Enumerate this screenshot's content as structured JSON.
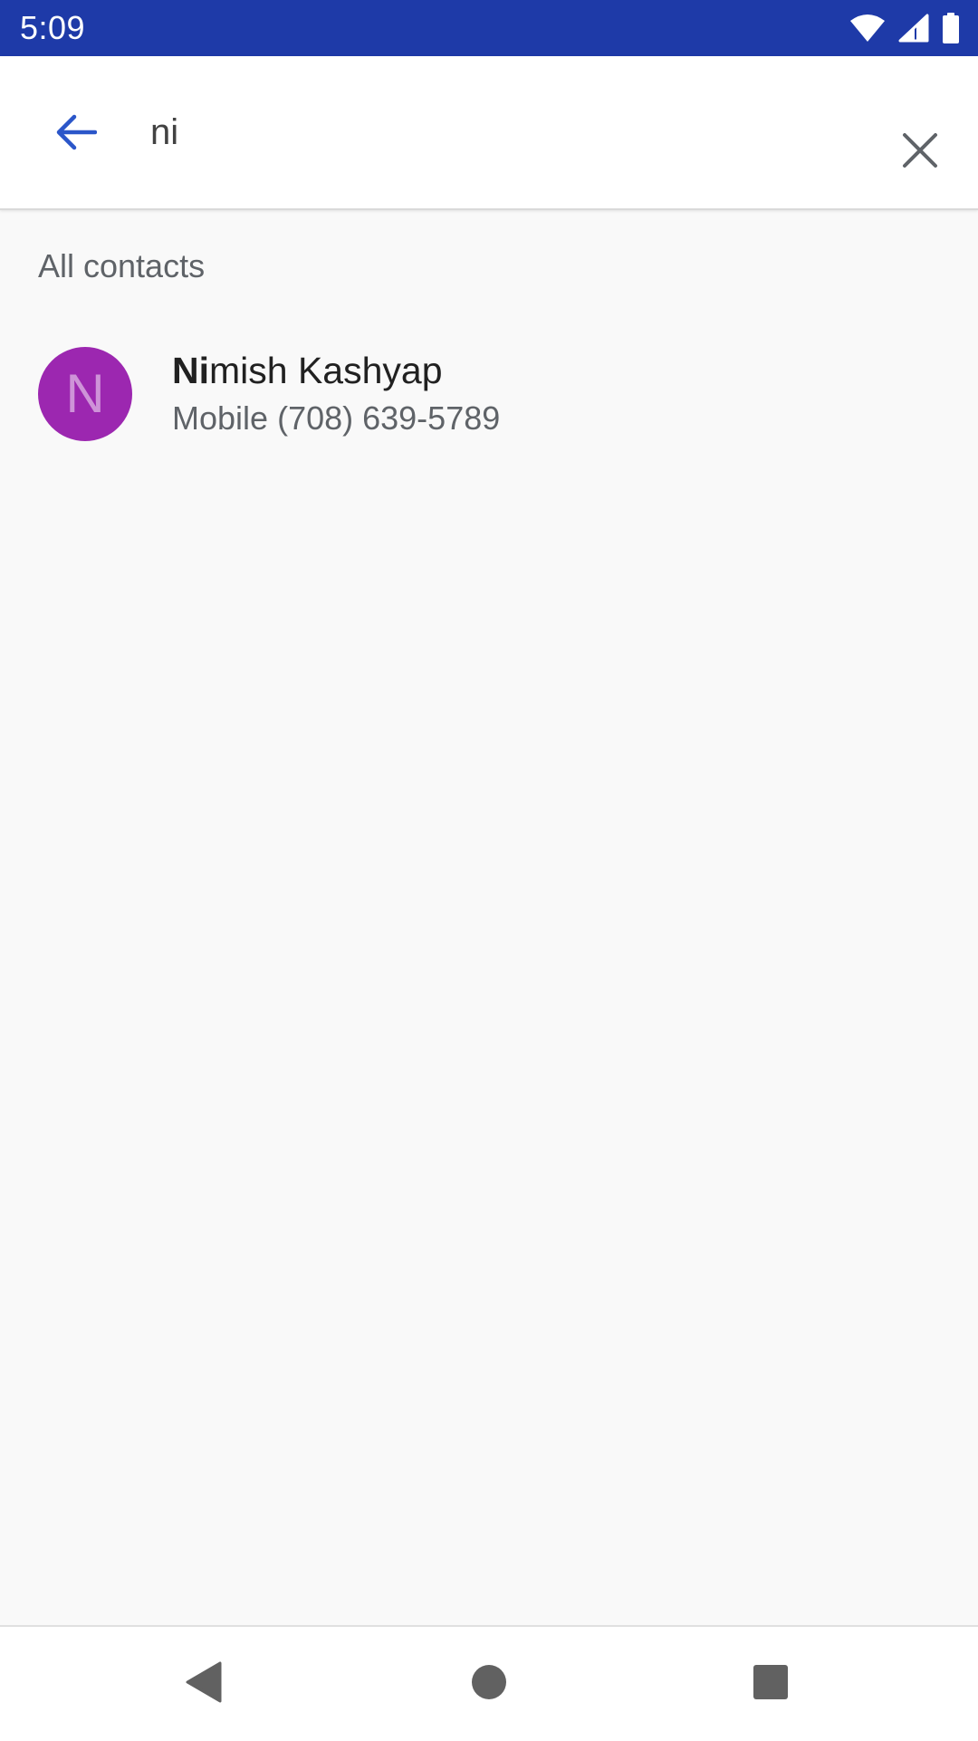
{
  "status_bar": {
    "time": "5:09",
    "icons": [
      "wifi-icon",
      "cell-signal-icon",
      "battery-icon"
    ],
    "background_color": "#1e3aa8"
  },
  "search": {
    "query": "ni",
    "back_icon": "arrow-back-icon",
    "clear_icon": "close-icon",
    "accent_color": "#2b56c9"
  },
  "results": {
    "section_header": "All contacts",
    "contacts": [
      {
        "avatar_letter": "N",
        "avatar_color": "#9c27b0",
        "name_match": "Ni",
        "name_rest": "mish Kashyap",
        "phone_type": "Mobile",
        "phone_number": "(708) 639-5789"
      }
    ]
  },
  "nav_bar": {
    "icons": [
      "nav-back-icon",
      "nav-home-icon",
      "nav-recents-icon"
    ]
  }
}
